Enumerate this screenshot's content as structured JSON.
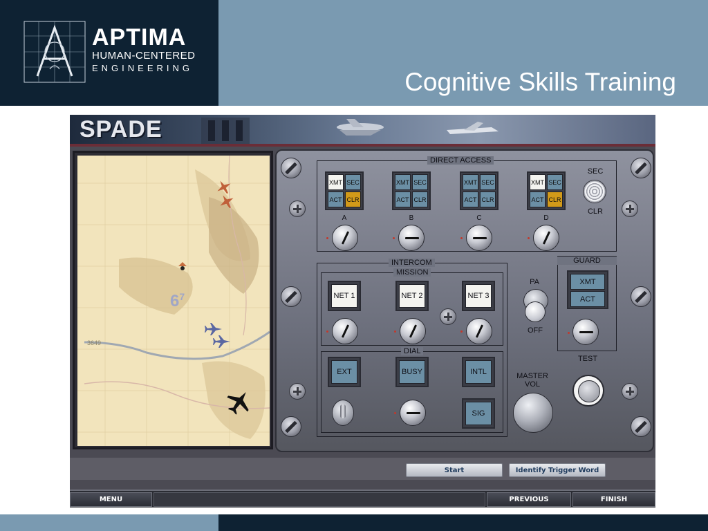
{
  "header": {
    "brand_name": "APTIMA",
    "brand_line1": "HUMAN-CENTERED",
    "brand_line2": "ENGINEERING",
    "slide_title": "Cognitive Skills Training",
    "colors": {
      "dark": "#0e2233",
      "light": "#7a9ab1"
    }
  },
  "app": {
    "title": "SPADE",
    "map": {
      "labels": [
        "6",
        "7",
        "3649"
      ],
      "aircraft_icons": [
        "red-fighter-icon",
        "red-fighter-icon",
        "blue-fighter-icon",
        "blue-fighter-icon",
        "black-bomber-icon"
      ]
    },
    "panel": {
      "direct_access": {
        "title": "DIRECT ACCESS",
        "channels": [
          {
            "label": "A",
            "xmt": "XMT",
            "sec": "SEC",
            "act": "ACT",
            "clr": "CLR",
            "xmt_lit": true,
            "clr_lit": true
          },
          {
            "label": "B",
            "xmt": "XMT",
            "sec": "SEC",
            "act": "ACT",
            "clr": "CLR",
            "xmt_lit": false,
            "clr_lit": false
          },
          {
            "label": "C",
            "xmt": "XMT",
            "sec": "SEC",
            "act": "ACT",
            "clr": "CLR",
            "xmt_lit": false,
            "clr_lit": false
          },
          {
            "label": "D",
            "xmt": "XMT",
            "sec": "SEC",
            "act": "ACT",
            "clr": "CLR",
            "xmt_lit": true,
            "clr_lit": true
          }
        ],
        "sec_label": "SEC",
        "clr_label": "CLR"
      },
      "intercom": {
        "title": "INTERCOM",
        "mission_title": "MISSION",
        "nets": [
          "NET 1",
          "NET 2",
          "NET 3"
        ],
        "dial_title": "DIAL",
        "dial_buttons": [
          "EXT",
          "BUSY",
          "INTL"
        ],
        "sig": "SIG"
      },
      "pa": {
        "on": "PA",
        "off": "OFF"
      },
      "guard": {
        "title": "GUARD",
        "xmt": "XMT",
        "act": "ACT"
      },
      "test": "TEST",
      "master_vol_line1": "MASTER",
      "master_vol_line2": "VOL"
    },
    "buttons": {
      "start": "Start",
      "identify": "Identify Trigger Word"
    },
    "nav": {
      "menu": "MENU",
      "previous": "PREVIOUS",
      "finish": "FINISH"
    }
  }
}
